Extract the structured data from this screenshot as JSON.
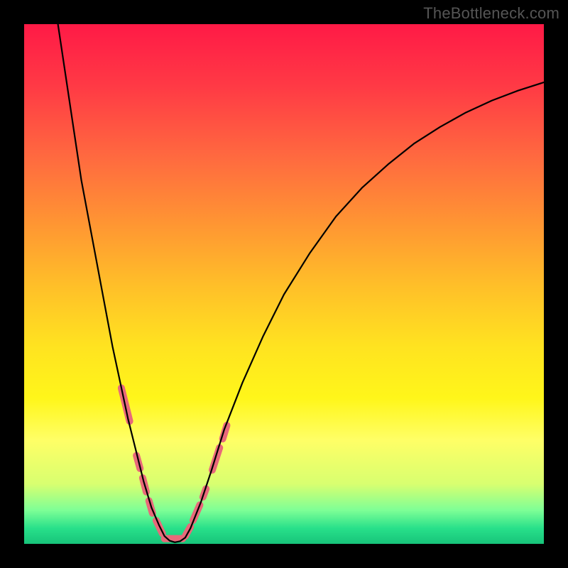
{
  "watermark": "TheBottleneck.com",
  "chart_data": {
    "type": "line",
    "title": "",
    "xlabel": "",
    "ylabel": "",
    "xlim": [
      0,
      100
    ],
    "ylim": [
      0,
      100
    ],
    "gradient_stops": [
      {
        "pos": 0,
        "color": "#ff1a46"
      },
      {
        "pos": 12,
        "color": "#ff3a45"
      },
      {
        "pos": 26,
        "color": "#ff6b3f"
      },
      {
        "pos": 38,
        "color": "#ff9433"
      },
      {
        "pos": 50,
        "color": "#ffbe29"
      },
      {
        "pos": 62,
        "color": "#ffe320"
      },
      {
        "pos": 72,
        "color": "#fff61a"
      },
      {
        "pos": 80,
        "color": "#ffff66"
      },
      {
        "pos": 88.5,
        "color": "#d8ff70"
      },
      {
        "pos": 93.5,
        "color": "#7eff96"
      },
      {
        "pos": 97,
        "color": "#28e08a"
      },
      {
        "pos": 100,
        "color": "#17c47a"
      }
    ],
    "series": [
      {
        "name": "curve",
        "color": "#000000",
        "points": [
          {
            "x": 6.5,
            "y": 100
          },
          {
            "x": 8.0,
            "y": 90
          },
          {
            "x": 9.5,
            "y": 80
          },
          {
            "x": 11.0,
            "y": 70
          },
          {
            "x": 12.5,
            "y": 62
          },
          {
            "x": 14.0,
            "y": 54
          },
          {
            "x": 15.5,
            "y": 46
          },
          {
            "x": 17.0,
            "y": 38
          },
          {
            "x": 18.5,
            "y": 31
          },
          {
            "x": 20.0,
            "y": 24
          },
          {
            "x": 21.5,
            "y": 18
          },
          {
            "x": 23.0,
            "y": 12
          },
          {
            "x": 24.5,
            "y": 7
          },
          {
            "x": 26.0,
            "y": 3.5
          },
          {
            "x": 27.0,
            "y": 1.5
          },
          {
            "x": 28.0,
            "y": 0.6
          },
          {
            "x": 29.0,
            "y": 0.3
          },
          {
            "x": 30.0,
            "y": 0.5
          },
          {
            "x": 31.0,
            "y": 1.2
          },
          {
            "x": 32.0,
            "y": 3
          },
          {
            "x": 34.0,
            "y": 8
          },
          {
            "x": 36.0,
            "y": 14
          },
          {
            "x": 38.5,
            "y": 22
          },
          {
            "x": 42.0,
            "y": 31
          },
          {
            "x": 46.0,
            "y": 40
          },
          {
            "x": 50.0,
            "y": 48
          },
          {
            "x": 55.0,
            "y": 56
          },
          {
            "x": 60.0,
            "y": 63
          },
          {
            "x": 65.0,
            "y": 68.5
          },
          {
            "x": 70.0,
            "y": 73
          },
          {
            "x": 75.0,
            "y": 77
          },
          {
            "x": 80.0,
            "y": 80.2
          },
          {
            "x": 85.0,
            "y": 83
          },
          {
            "x": 90.0,
            "y": 85.3
          },
          {
            "x": 95.0,
            "y": 87.2
          },
          {
            "x": 100.0,
            "y": 88.8
          }
        ]
      }
    ],
    "marker_segments": {
      "color": "#e8697a",
      "width": 10,
      "segments": [
        {
          "from": {
            "x": 18.7,
            "y": 30
          },
          "to": {
            "x": 20.3,
            "y": 23.6
          }
        },
        {
          "from": {
            "x": 21.6,
            "y": 17
          },
          "to": {
            "x": 22.3,
            "y": 14.5
          }
        },
        {
          "from": {
            "x": 22.8,
            "y": 12.7
          },
          "to": {
            "x": 23.5,
            "y": 10
          }
        },
        {
          "from": {
            "x": 24.0,
            "y": 8.3
          },
          "to": {
            "x": 24.7,
            "y": 5.9
          }
        },
        {
          "from": {
            "x": 25.4,
            "y": 4.5
          },
          "to": {
            "x": 26.6,
            "y": 2.0
          }
        },
        {
          "from": {
            "x": 27.0,
            "y": 1.0
          },
          "to": {
            "x": 30.5,
            "y": 1.0
          }
        },
        {
          "from": {
            "x": 31.0,
            "y": 1.5
          },
          "to": {
            "x": 32.0,
            "y": 3.3
          }
        },
        {
          "from": {
            "x": 32.5,
            "y": 4.5
          },
          "to": {
            "x": 33.8,
            "y": 7.5
          }
        },
        {
          "from": {
            "x": 34.4,
            "y": 9.0
          },
          "to": {
            "x": 35.0,
            "y": 10.6
          }
        },
        {
          "from": {
            "x": 36.2,
            "y": 14.2
          },
          "to": {
            "x": 37.6,
            "y": 18.5
          }
        },
        {
          "from": {
            "x": 38.2,
            "y": 20.2
          },
          "to": {
            "x": 39.0,
            "y": 22.8
          }
        }
      ]
    }
  }
}
